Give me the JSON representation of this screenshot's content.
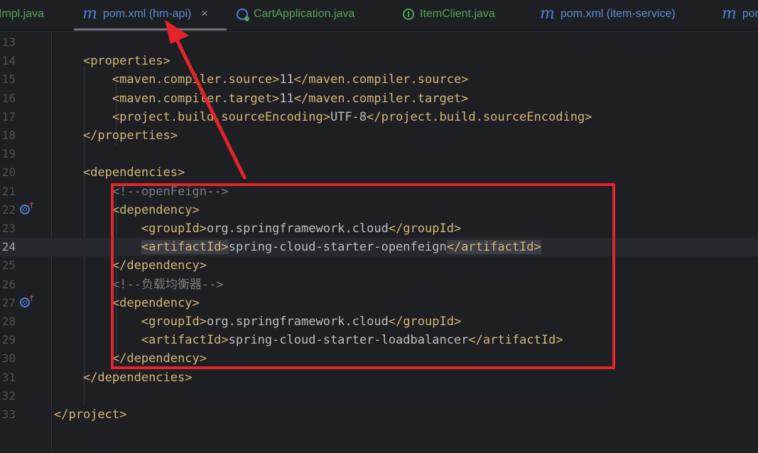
{
  "tabs": [
    {
      "label": "Impl.java",
      "type": "java"
    },
    {
      "label": "pom.xml (hm-api)",
      "type": "maven",
      "active": true,
      "close": "×"
    },
    {
      "label": "CartApplication.java",
      "type": "class"
    },
    {
      "label": "ItemClient.java",
      "type": "interface"
    },
    {
      "label": "pom.xml (item-service)",
      "type": "maven"
    },
    {
      "label": "pom",
      "type": "maven"
    }
  ],
  "lines": [
    {
      "n": "13",
      "text": ""
    },
    {
      "n": "14",
      "text": "    <properties>"
    },
    {
      "n": "15",
      "text": "        <maven.compiler.source>11</maven.compiler.source>"
    },
    {
      "n": "16",
      "text": "        <maven.compiler.target>11</maven.compiler.target>"
    },
    {
      "n": "17",
      "text": "        <project.build.sourceEncoding>UTF-8</project.build.sourceEncoding>"
    },
    {
      "n": "18",
      "text": "    </properties>"
    },
    {
      "n": "19",
      "text": ""
    },
    {
      "n": "20",
      "text": "    <dependencies>"
    },
    {
      "n": "21",
      "text": "        <!--openFeign-->"
    },
    {
      "n": "22",
      "text": "        <dependency>"
    },
    {
      "n": "23",
      "text": "            <groupId>org.springframework.cloud</groupId>"
    },
    {
      "n": "24",
      "text": "            <artifactId>spring-cloud-starter-openfeign</artifactId>"
    },
    {
      "n": "25",
      "text": "        </dependency>"
    },
    {
      "n": "26",
      "text": "        <!--负载均衡器-->"
    },
    {
      "n": "27",
      "text": "        <dependency>"
    },
    {
      "n": "28",
      "text": "            <groupId>org.springframework.cloud</groupId>"
    },
    {
      "n": "29",
      "text": "            <artifactId>spring-cloud-starter-loadbalancer</artifactId>"
    },
    {
      "n": "30",
      "text": "        </dependency>"
    },
    {
      "n": "31",
      "text": "    </dependencies>"
    },
    {
      "n": "32",
      "text": ""
    },
    {
      "n": "33",
      "text": "</project>"
    }
  ],
  "current_line": "24",
  "gutter_icons_lines": [
    "22",
    "27"
  ],
  "colors": {
    "background": "#1e1f22",
    "tag": "#d5b778",
    "text": "#bcbec4",
    "comment": "#7a7e85",
    "annotation_red": "#e3242b",
    "maven_blue": "#5d8cd6",
    "java_green": "#55a25c"
  }
}
